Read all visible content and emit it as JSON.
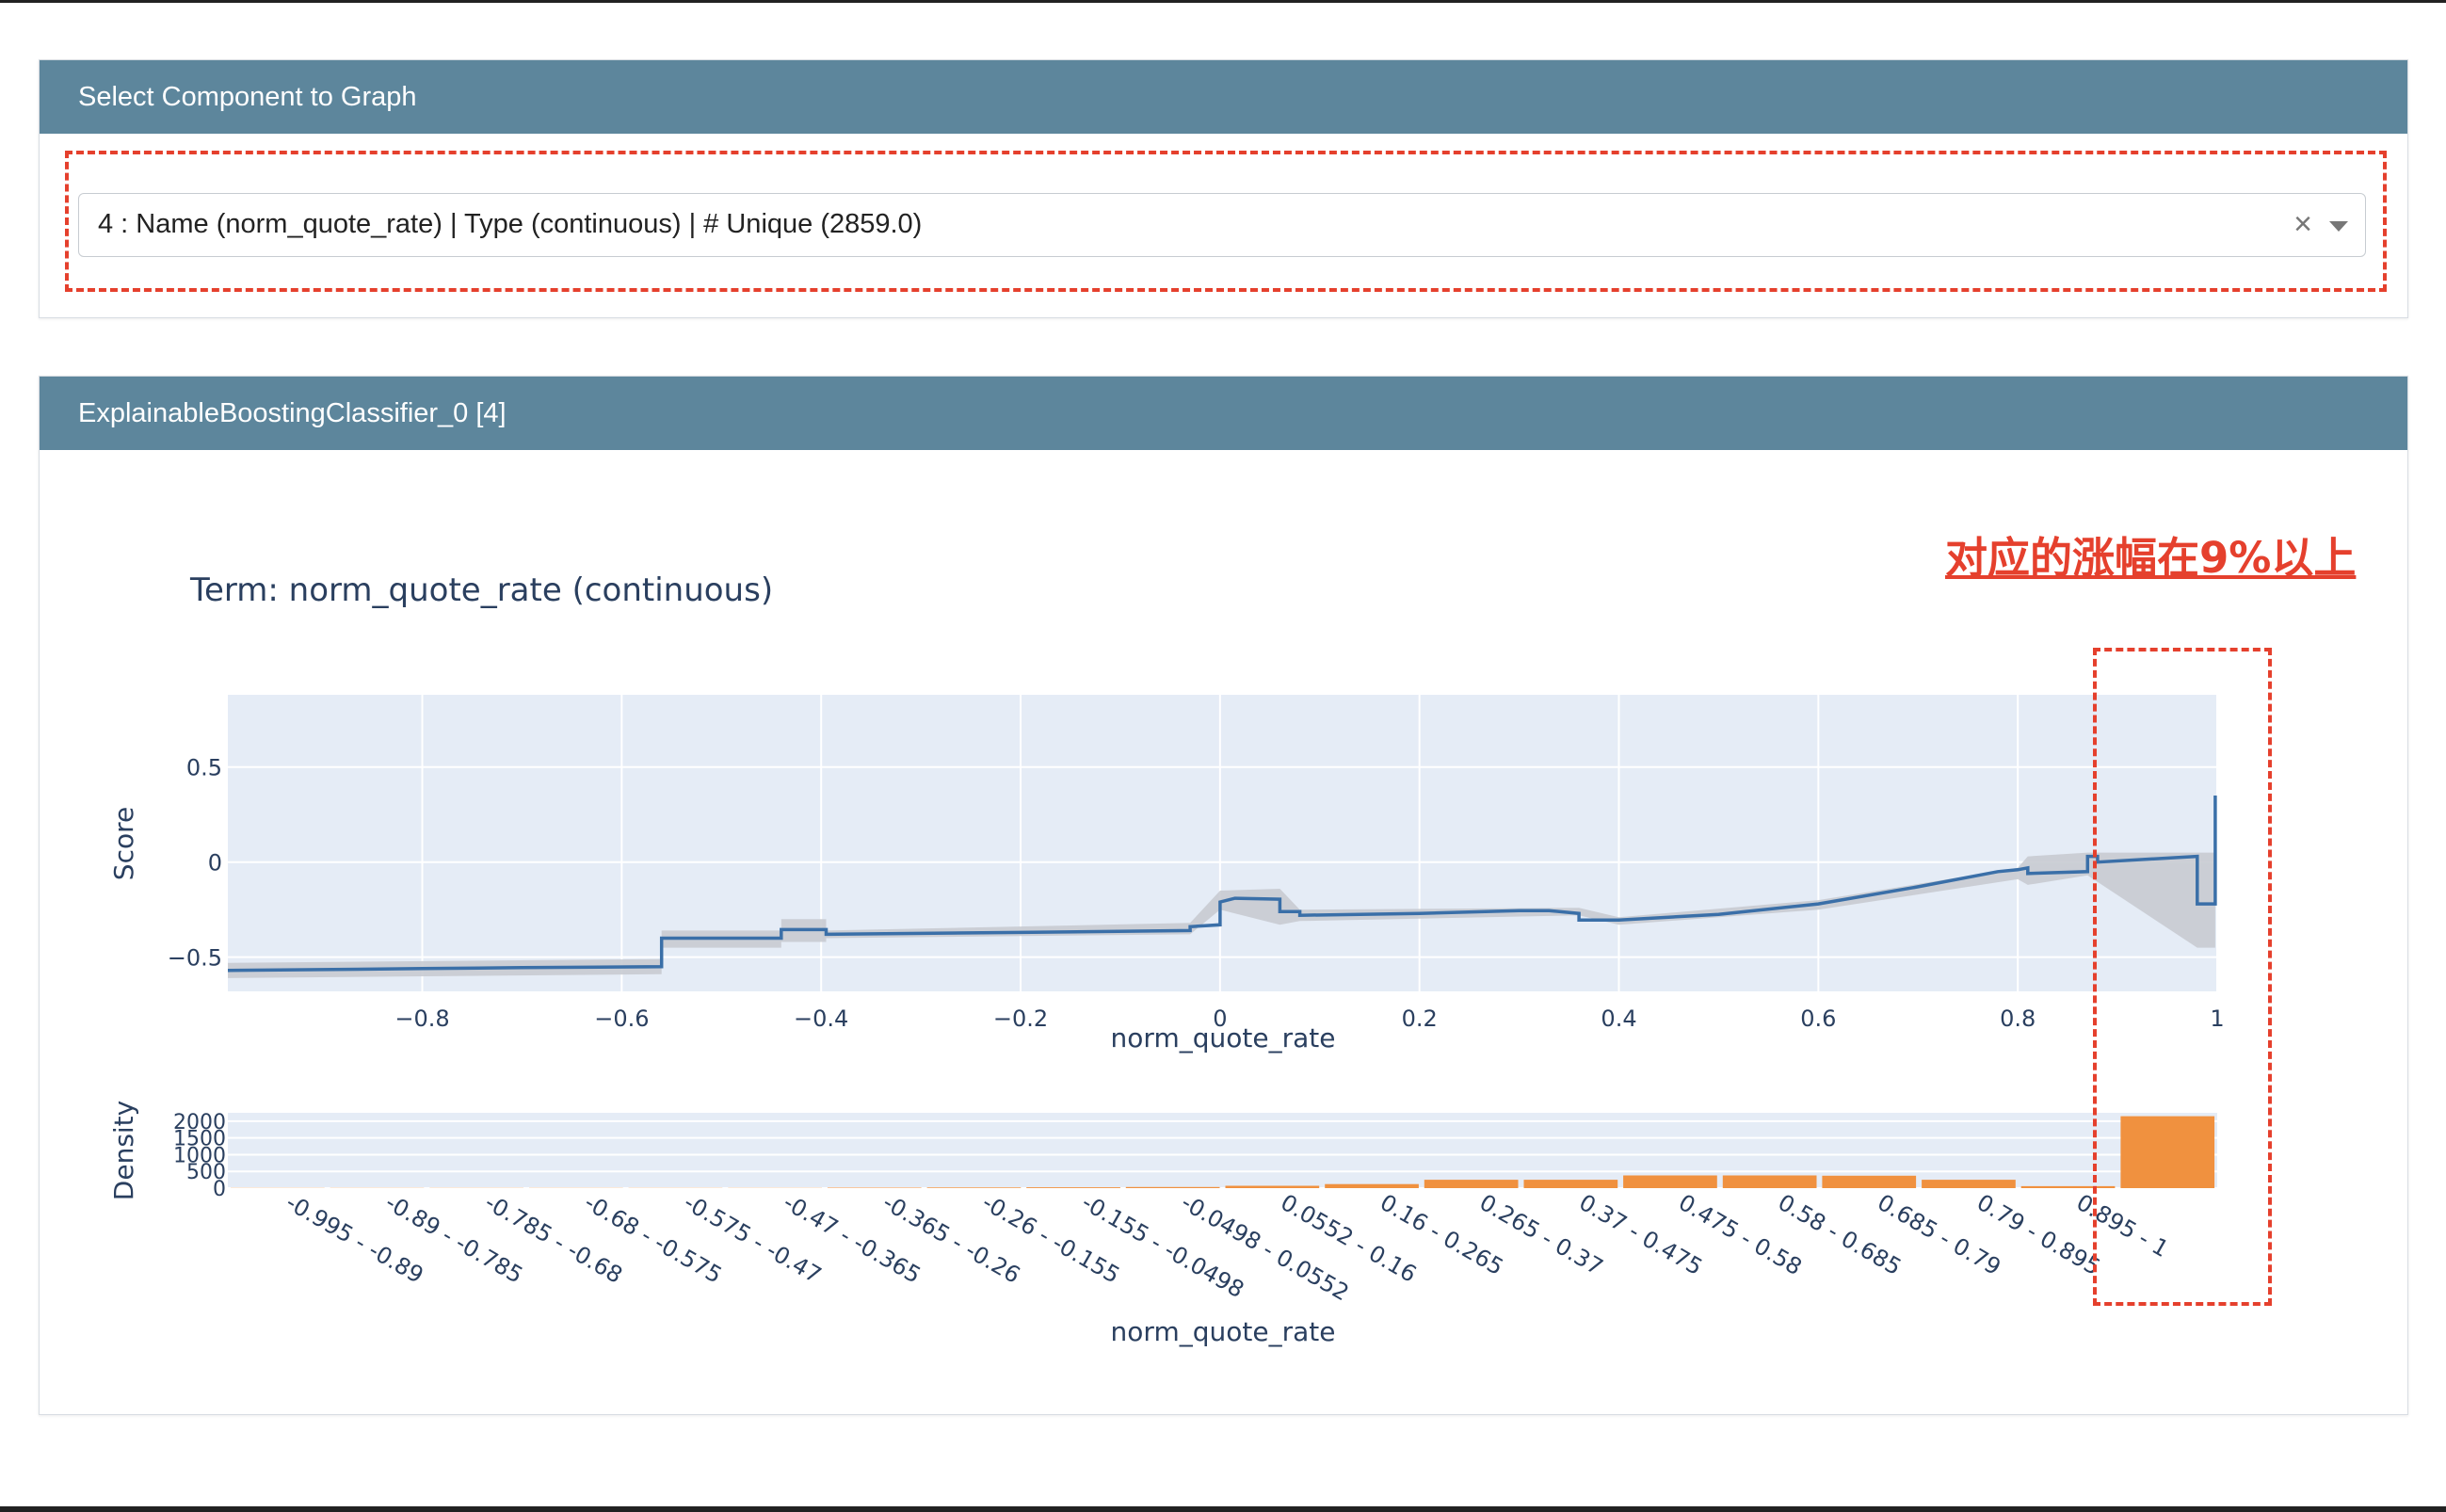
{
  "selector": {
    "header": "Select Component to Graph",
    "value": "4 : Name (norm_quote_rate) | Type (continuous) | # Unique (2859.0)",
    "clear_symbol": "×"
  },
  "chart_card": {
    "header": "ExplainableBoostingClassifier_0 [4]"
  },
  "annotation": {
    "text": "对应的涨幅在9%以上",
    "color": "#e5402d"
  },
  "chart_data": [
    {
      "type": "line",
      "title": "Term: norm_quote_rate (continuous)",
      "xlabel": "norm_quote_rate",
      "ylabel": "Score",
      "xlim": [
        -0.995,
        1
      ],
      "ylim": [
        -0.68,
        0.88
      ],
      "xticks": [
        -0.8,
        -0.6,
        -0.4,
        -0.2,
        0,
        0.2,
        0.4,
        0.6,
        0.8,
        1
      ],
      "xtick_labels": [
        "−0.8",
        "−0.6",
        "−0.4",
        "−0.2",
        "0",
        "0.2",
        "0.4",
        "0.6",
        "0.8",
        "1"
      ],
      "yticks": [
        0.5,
        0,
        -0.5
      ],
      "ytick_labels": [
        "0.5",
        "0",
        "−0.5"
      ],
      "grid": true,
      "line_color": "#3a6fa8",
      "band_color": "#c8cbd1",
      "series": [
        {
          "x": [
            -0.995,
            -0.8,
            -0.7,
            -0.56,
            -0.56,
            -0.44,
            -0.44,
            -0.395,
            -0.395,
            -0.2,
            -0.03,
            -0.03,
            0.0,
            0.0,
            0.015,
            0.015,
            0.06,
            0.06,
            0.08,
            0.08,
            0.2,
            0.3,
            0.33,
            0.36,
            0.36,
            0.4,
            0.5,
            0.6,
            0.7,
            0.78,
            0.8,
            0.81,
            0.81,
            0.87,
            0.87,
            0.88,
            0.88,
            0.98,
            0.98,
            0.998,
            0.998
          ],
          "y": [
            -0.57,
            -0.56,
            -0.555,
            -0.55,
            -0.4,
            -0.4,
            -0.355,
            -0.355,
            -0.38,
            -0.37,
            -0.36,
            -0.34,
            -0.33,
            -0.21,
            -0.19,
            -0.19,
            -0.195,
            -0.26,
            -0.26,
            -0.28,
            -0.27,
            -0.255,
            -0.255,
            -0.27,
            -0.305,
            -0.305,
            -0.275,
            -0.22,
            -0.13,
            -0.05,
            -0.04,
            -0.03,
            -0.06,
            -0.05,
            0.03,
            0.03,
            0.0,
            0.03,
            -0.22,
            -0.22,
            0.35
          ],
          "band": {
            "x": [
              -0.995,
              -0.56,
              -0.56,
              -0.44,
              -0.44,
              -0.395,
              -0.395,
              -0.03,
              0.0,
              0.06,
              0.08,
              0.36,
              0.4,
              0.6,
              0.8,
              0.81,
              0.87,
              0.98,
              0.998
            ],
            "upper": [
              -0.53,
              -0.51,
              -0.36,
              -0.36,
              -0.3,
              -0.3,
              -0.36,
              -0.32,
              -0.15,
              -0.14,
              -0.25,
              -0.24,
              -0.29,
              -0.2,
              -0.03,
              0.03,
              0.05,
              0.05,
              0.05
            ],
            "lower": [
              -0.61,
              -0.59,
              -0.45,
              -0.45,
              -0.42,
              -0.42,
              -0.4,
              -0.38,
              -0.25,
              -0.33,
              -0.31,
              -0.28,
              -0.33,
              -0.25,
              -0.09,
              -0.12,
              -0.07,
              -0.45,
              -0.45
            ]
          }
        }
      ]
    },
    {
      "type": "bar",
      "xlabel": "norm_quote_rate",
      "ylabel": "Density",
      "ylim": [
        0,
        2250
      ],
      "yticks": [
        0,
        500,
        1000,
        1500,
        2000
      ],
      "ytick_labels": [
        "0",
        "500",
        "1000",
        "1500",
        "2000"
      ],
      "bar_color": "#f0913f",
      "categories": [
        "-0.995 - -0.89",
        "-0.89 - -0.785",
        "-0.785 - -0.68",
        "-0.68 - -0.575",
        "-0.575 - -0.47",
        "-0.47 - -0.365",
        "-0.365 - -0.26",
        "-0.26 - -0.155",
        "-0.155 - -0.0498",
        "-0.0498 - 0.0552",
        "0.0552 - 0.16",
        "0.16 - 0.265",
        "0.265 - 0.37",
        "0.37 - 0.475",
        "0.475 - 0.58",
        "0.58 - 0.685",
        "0.685 - 0.79",
        "0.79 - 0.895",
        "0.895 - 1"
      ],
      "values": [
        5,
        5,
        5,
        5,
        5,
        5,
        15,
        20,
        25,
        35,
        70,
        120,
        250,
        250,
        380,
        380,
        370,
        250,
        60,
        2150
      ]
    }
  ]
}
